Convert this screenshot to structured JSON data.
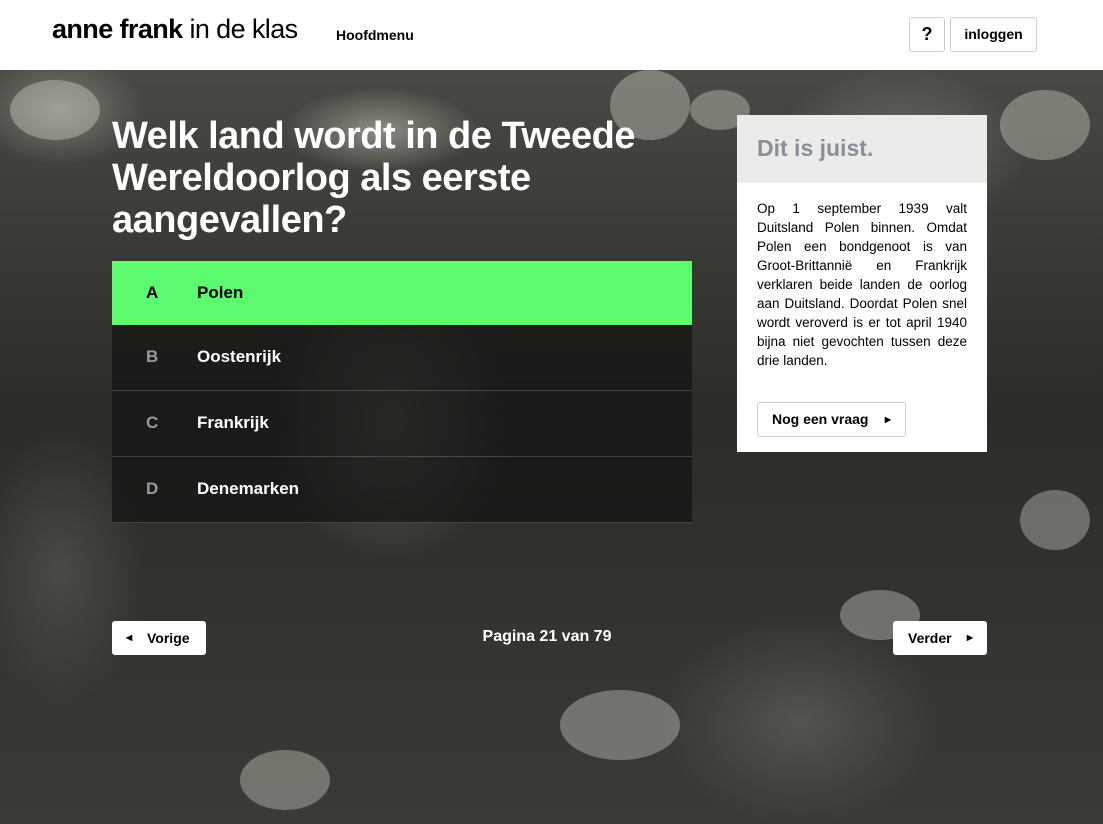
{
  "header": {
    "logo_bold": "anne frank",
    "logo_light": " in de klas",
    "main_menu": "Hoofdmenu",
    "help_label": "?",
    "login_label": "inloggen"
  },
  "quiz": {
    "question": "Welk land wordt in de Tweede Wereldoorlog als eerste aangevallen?",
    "answers": [
      {
        "letter": "A",
        "text": "Polen"
      },
      {
        "letter": "B",
        "text": "Oostenrijk"
      },
      {
        "letter": "C",
        "text": "Frankrijk"
      },
      {
        "letter": "D",
        "text": "Denemarken"
      }
    ]
  },
  "feedback": {
    "title": "Dit is juist.",
    "body": "Op 1 september 1939 valt Duitsland Polen binnen. Omdat Polen een bondgenoot is van Groot-Brittannië en Frankrijk verklaren beide landen de oorlog aan Duitsland. Doordat Polen snel wordt veroverd is er tot april 1940 bijna niet gevochten tussen deze drie landen.",
    "next_question_label": "Nog een vraag"
  },
  "pagination": {
    "prev_label": "Vorige",
    "next_label": "Verder",
    "page_info": "Pagina 21 van 79"
  },
  "colors": {
    "correct_answer": "#5cfa6e",
    "feedback_title": "#8a8e98"
  },
  "icons": {
    "prev_arrow": "triangle-left-icon",
    "next_arrow": "triangle-right-icon"
  }
}
